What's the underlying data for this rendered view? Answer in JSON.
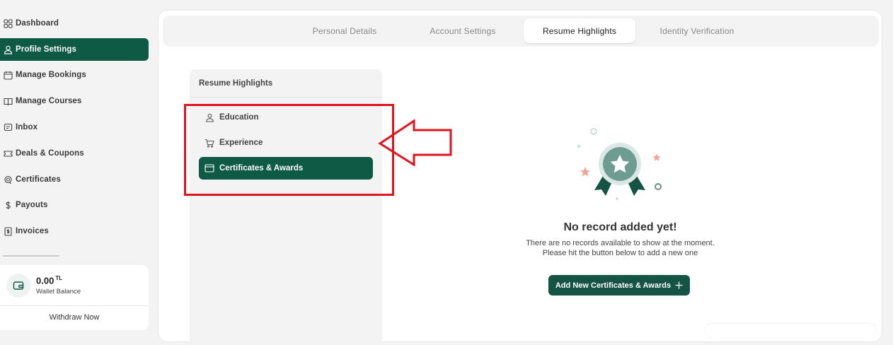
{
  "sidebar": {
    "items": [
      {
        "label": "Dashboard",
        "icon": "grid-icon"
      },
      {
        "label": "Profile Settings",
        "icon": "user-icon"
      },
      {
        "label": "Manage Bookings",
        "icon": "calendar-icon"
      },
      {
        "label": "Manage Courses",
        "icon": "book-icon"
      },
      {
        "label": "Inbox",
        "icon": "message-icon"
      },
      {
        "label": "Deals & Coupons",
        "icon": "ticket-icon"
      },
      {
        "label": "Certificates",
        "icon": "badge-icon"
      },
      {
        "label": "Payouts",
        "icon": "dollar-icon"
      },
      {
        "label": "Invoices",
        "icon": "invoice-icon"
      }
    ],
    "active_index": 1,
    "accent": "#0e5a45"
  },
  "wallet": {
    "amount": "0.00",
    "currency": "TL",
    "label": "Wallet Balance",
    "withdraw_label": "Withdraw Now"
  },
  "tabs": [
    {
      "label": "Personal Details"
    },
    {
      "label": "Account Settings"
    },
    {
      "label": "Resume Highlights"
    },
    {
      "label": "Identity Verification"
    }
  ],
  "active_tab": 2,
  "resume_panel": {
    "title": "Resume Highlights",
    "items": [
      {
        "label": "Education",
        "icon": "graduate-icon"
      },
      {
        "label": "Experience",
        "icon": "cart-icon"
      },
      {
        "label": "Certificates & Awards",
        "icon": "card-icon"
      }
    ],
    "active_index": 2
  },
  "empty_state": {
    "icon": "award-ribbon-icon",
    "title": "No record added yet!",
    "line1": "There are no records available to show at the moment.",
    "line2": "Please hit the button below to add a new one",
    "button_label": "Add New Certificates & Awards",
    "button_icon": "plus-icon"
  },
  "annotation": {
    "color": "#e0141e"
  }
}
